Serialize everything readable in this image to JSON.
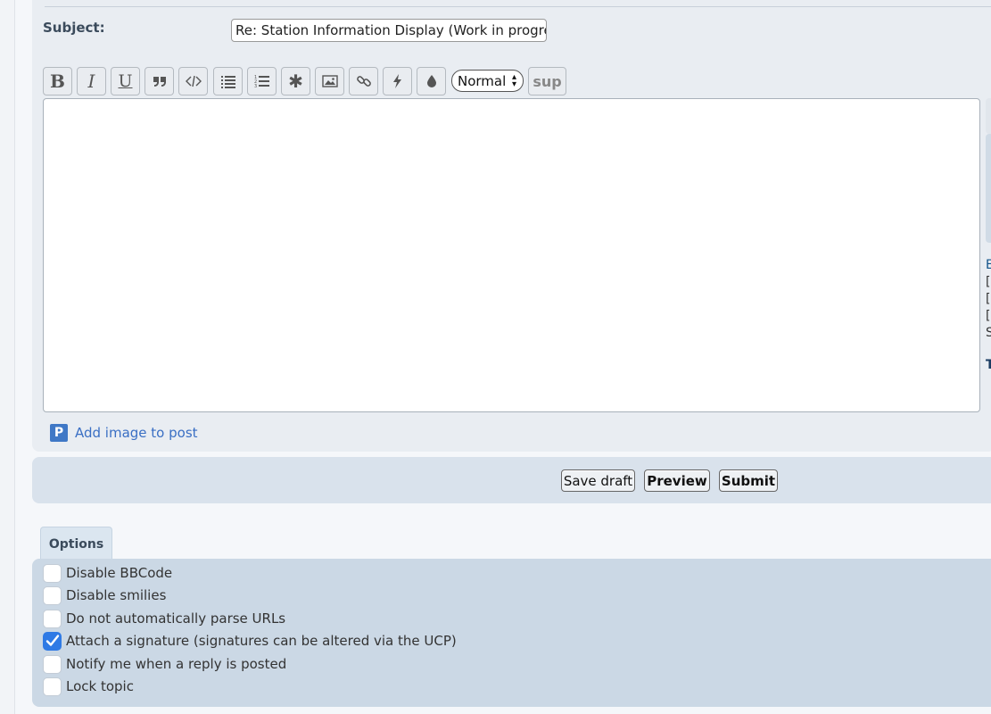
{
  "subject": {
    "label": "Subject:",
    "value": "Re: Station Information Display (Work in progres"
  },
  "toolbar": {
    "buttons": [
      {
        "name": "bold-button",
        "glyph": "B",
        "icon": "bold-icon"
      },
      {
        "name": "italic-button",
        "glyph": "I",
        "icon": "italic-icon"
      },
      {
        "name": "underline-button",
        "glyph": "U",
        "icon": "underline-icon"
      },
      {
        "name": "quote-button",
        "glyph": "“",
        "icon": "quote-icon"
      },
      {
        "name": "code-button",
        "glyph": "</>",
        "icon": "code-icon"
      },
      {
        "name": "list-button",
        "glyph": "",
        "icon": "list-icon"
      },
      {
        "name": "ordered-list-button",
        "glyph": "",
        "icon": "ordered-list-icon"
      },
      {
        "name": "list-item-button",
        "glyph": "✱",
        "icon": "asterisk-icon"
      },
      {
        "name": "image-button",
        "glyph": "",
        "icon": "image-icon"
      },
      {
        "name": "link-button",
        "glyph": "",
        "icon": "link-icon"
      },
      {
        "name": "flash-button",
        "glyph": "",
        "icon": "lightning-icon"
      },
      {
        "name": "color-button",
        "glyph": "",
        "icon": "droplet-icon"
      }
    ],
    "font_size_value": "Normal",
    "sup_label": "sup"
  },
  "message": {
    "value": ""
  },
  "right_peek": {
    "lines": [
      "E",
      "[",
      "[",
      "[",
      "S",
      "T"
    ]
  },
  "add_image": {
    "icon_glyph": "P",
    "label": "Add image to post"
  },
  "actions": {
    "save_draft": "Save draft",
    "preview": "Preview",
    "submit": "Submit"
  },
  "options": {
    "tab_label": "Options",
    "items": [
      {
        "label": "Disable BBCode",
        "checked": false
      },
      {
        "label": "Disable smilies",
        "checked": false
      },
      {
        "label": "Do not automatically parse URLs",
        "checked": false
      },
      {
        "label": "Attach a signature (signatures can be altered via the UCP)",
        "checked": true
      },
      {
        "label": "Notify me when a reply is posted",
        "checked": false
      },
      {
        "label": "Lock topic",
        "checked": false
      }
    ]
  },
  "colors": {
    "accent": "#2f7ae5",
    "link": "#3a6fc4",
    "panel": "#cbd8e5"
  }
}
